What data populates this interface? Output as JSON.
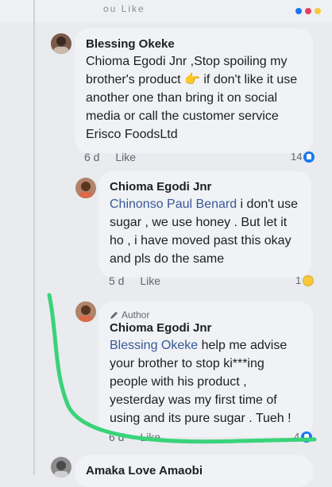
{
  "top_fragment": "ou Like",
  "comments": [
    {
      "author": "Blessing Okeke",
      "text": "Chioma Egodi Jnr ,Stop spoiling my brother's product 👉 if don't like it use another one than bring it on social media or call the customer service Erisco FoodsLtd",
      "time": "6 d",
      "like": "Like",
      "reaction_count": "14",
      "reaction_icon": "like-icon"
    },
    {
      "author": "Chioma Egodi Jnr",
      "mention": "Chinonso Paul Benard",
      "text": " i don't use sugar , we use honey . But let it ho , i have moved past this okay and pls do the same",
      "time": "5 d",
      "like": "Like",
      "reaction_count": "1",
      "reaction_icon": "laugh-icon"
    },
    {
      "badge": "Author",
      "author": "Chioma Egodi Jnr",
      "mention": "Blessing Okeke",
      "text": " help me advise your brother to stop ki***ing people with his product , yesterday was my first time of using and its pure sugar . Tueh !",
      "time": "6 d",
      "like": "Like",
      "reaction_count": "4",
      "reaction_icon": "like-icon"
    },
    {
      "author": "Amaka Love Amaobi"
    }
  ],
  "colors": {
    "mention": "#385898",
    "bubble": "#f0f2f5",
    "highlight": "#39d37a"
  }
}
